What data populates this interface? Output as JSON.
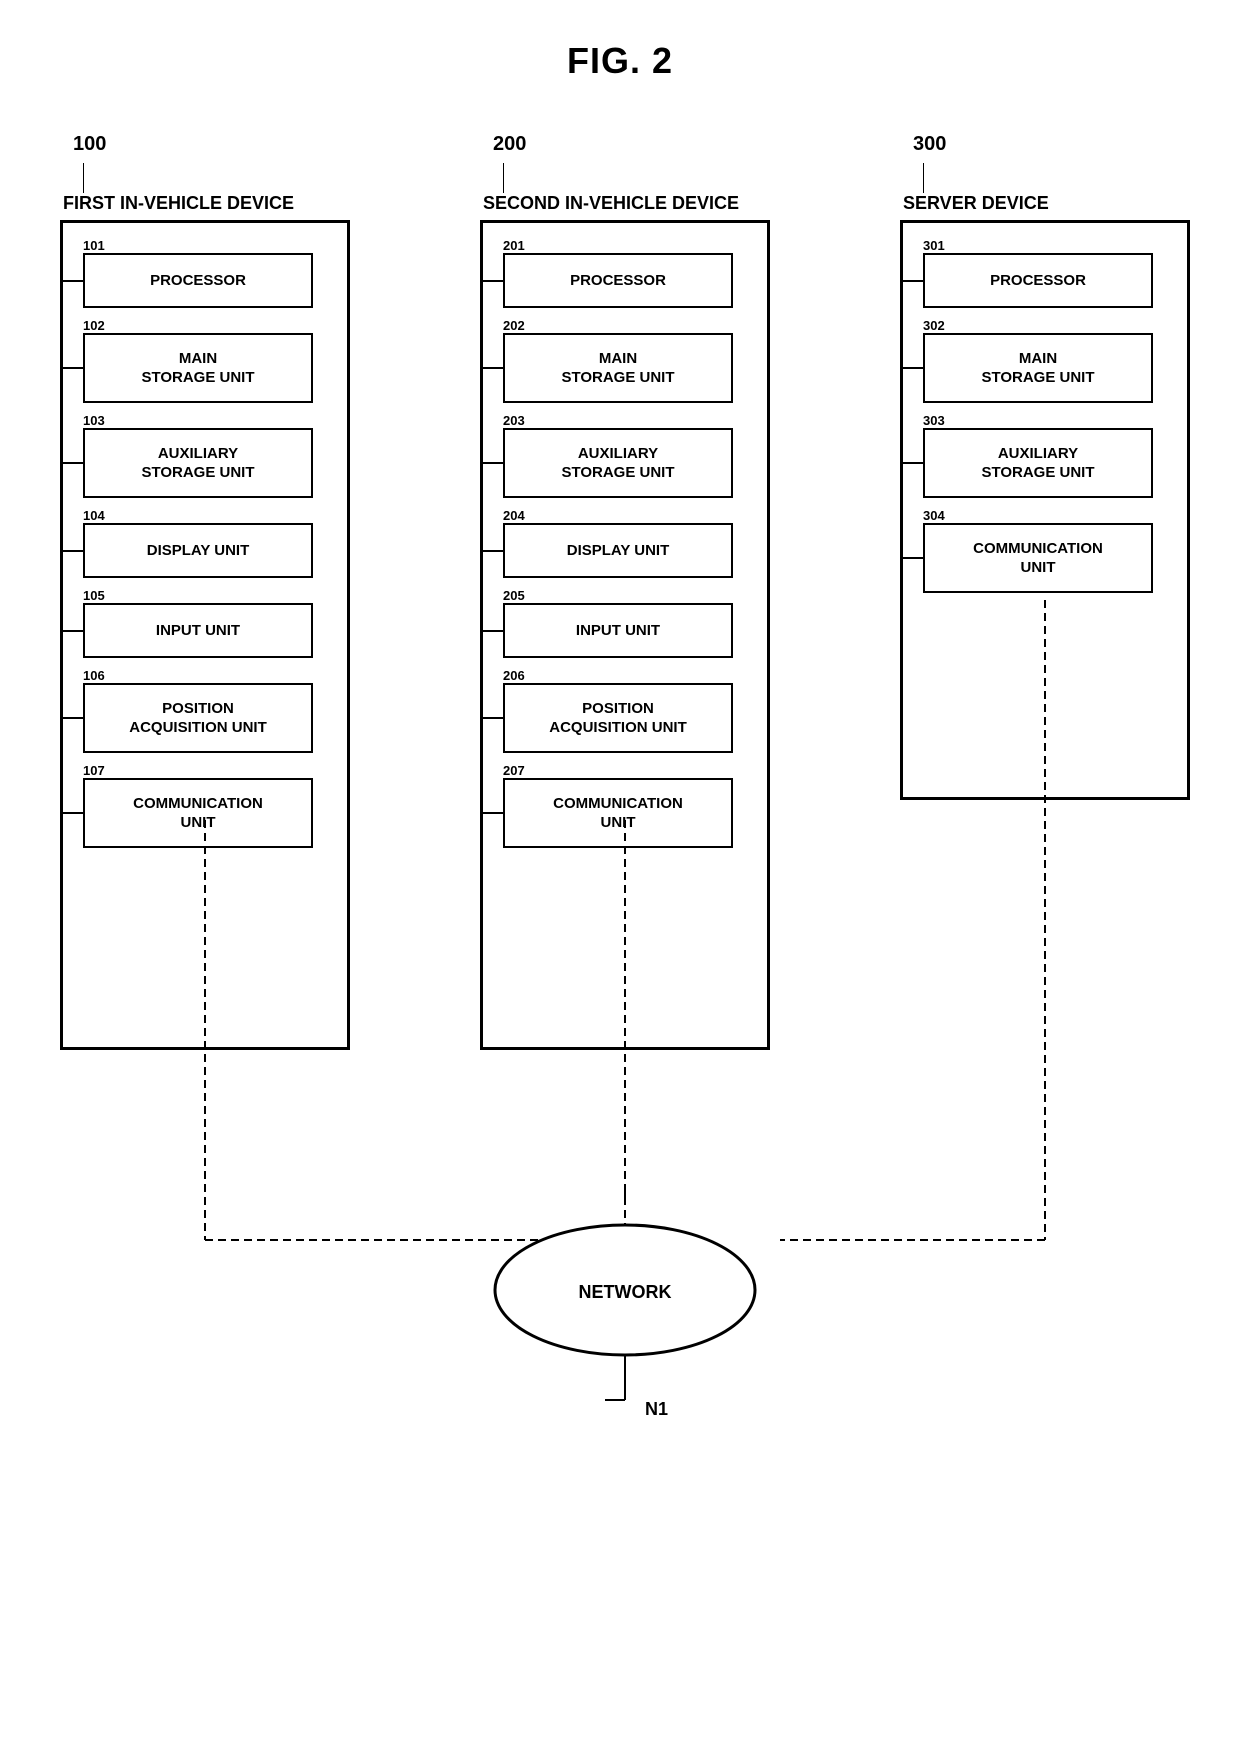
{
  "title": "FIG. 2",
  "devices": [
    {
      "id": "device1",
      "number": "100",
      "label": "FIRST IN-VEHICLE DEVICE",
      "components": [
        {
          "id": "101",
          "label": "PROCESSOR",
          "lines": 1
        },
        {
          "id": "102",
          "label": "MAIN\nSTORAGE UNIT",
          "lines": 2
        },
        {
          "id": "103",
          "label": "AUXILIARY\nSTORAGE UNIT",
          "lines": 2
        },
        {
          "id": "104",
          "label": "DISPLAY UNIT",
          "lines": 1
        },
        {
          "id": "105",
          "label": "INPUT UNIT",
          "lines": 1
        },
        {
          "id": "106",
          "label": "POSITION\nACQUISITION UNIT",
          "lines": 2
        },
        {
          "id": "107",
          "label": "COMMUNICATION\nUNIT",
          "lines": 2
        }
      ]
    },
    {
      "id": "device2",
      "number": "200",
      "label": "SECOND IN-VEHICLE DEVICE",
      "components": [
        {
          "id": "201",
          "label": "PROCESSOR",
          "lines": 1
        },
        {
          "id": "202",
          "label": "MAIN\nSTORAGE UNIT",
          "lines": 2
        },
        {
          "id": "203",
          "label": "AUXILIARY\nSTORAGE UNIT",
          "lines": 2
        },
        {
          "id": "204",
          "label": "DISPLAY UNIT",
          "lines": 1
        },
        {
          "id": "205",
          "label": "INPUT UNIT",
          "lines": 1
        },
        {
          "id": "206",
          "label": "POSITION\nACQUISITION UNIT",
          "lines": 2
        },
        {
          "id": "207",
          "label": "COMMUNICATION\nUNIT",
          "lines": 2
        }
      ]
    },
    {
      "id": "device3",
      "number": "300",
      "label": "SERVER DEVICE",
      "components": [
        {
          "id": "301",
          "label": "PROCESSOR",
          "lines": 1
        },
        {
          "id": "302",
          "label": "MAIN\nSTORAGE UNIT",
          "lines": 2
        },
        {
          "id": "303",
          "label": "AUXILIARY\nSTORAGE UNIT",
          "lines": 2
        },
        {
          "id": "304",
          "label": "COMMUNICATION\nUNIT",
          "lines": 2
        }
      ]
    }
  ],
  "network": {
    "label": "NETWORK",
    "id": "N1"
  }
}
